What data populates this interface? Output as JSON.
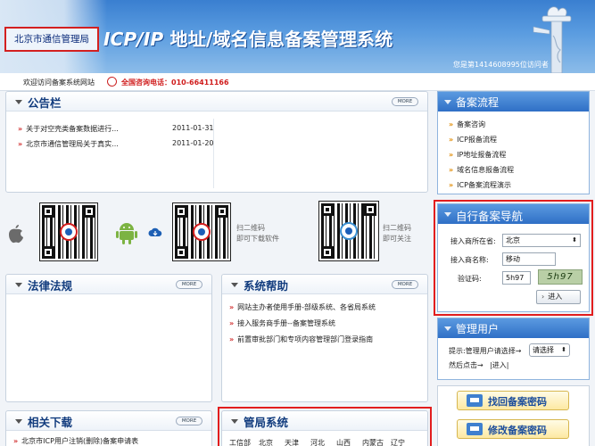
{
  "header": {
    "bureau_name": "北京市通信管理局",
    "title_latin": "ICP/IP",
    "title_cn": " 地址/域名信息备案管理系统",
    "visitor_text": "您是第1414608995位访问者"
  },
  "subbar": {
    "welcome": "欢迎访问备案系统网站",
    "hotline": "全国咨询电话：010-66411166"
  },
  "announcements": {
    "title": "公告栏",
    "more_label": "MORE",
    "items": [
      {
        "text": "关于对空壳类备案数据进行...",
        "date": "2011-01-31"
      },
      {
        "text": "北京市通信管理局关于真实...",
        "date": "2011-01-20"
      }
    ]
  },
  "downloads_strip": {
    "qr_caption_1": "扫二维码",
    "qr_caption_2": "即可下载软件",
    "follow_caption_1": "扫二维码",
    "follow_caption_2": "即可关注"
  },
  "law": {
    "title": "法律法规",
    "more_label": "MORE"
  },
  "help": {
    "title": "系统帮助",
    "more_label": "MORE",
    "items": [
      "网站主办者使用手册-部级系统、各省局系统",
      "接入服务商手册--备案管理系统",
      "前置审批部门和专项内容管理部门登录指南"
    ]
  },
  "related": {
    "title": "相关下载",
    "more_label": "MORE",
    "items": [
      "北京市ICP用户注销(删除)备案申请表"
    ]
  },
  "bureau_systems": {
    "title": "管局系统",
    "items": [
      "工信部",
      "北京",
      "天津",
      "河北",
      "山西",
      "内蒙古",
      "辽宁"
    ]
  },
  "process": {
    "title": "备案流程",
    "items": [
      "备案咨询",
      "ICP报备流程",
      "IP地址报备流程",
      "域名信息报备流程",
      "ICP备案流程演示"
    ]
  },
  "nav": {
    "title": "自行备案导航",
    "province_label": "接入商所在省:",
    "province_value": "北京",
    "name_label": "接入商名称:",
    "name_value": "移动",
    "captcha_label": "验证码:",
    "captcha_value": "5h97",
    "captcha_image_text": "5h97",
    "enter_label": "进入"
  },
  "admin": {
    "title": "管理用户",
    "hint_prefix": "提示:管理用户请选择→",
    "select_value": "请选择",
    "hint_suffix": "然后点击→",
    "enter_label": "|进入|"
  },
  "buttons": {
    "find_password": "找回备案密码",
    "change_password": "修改备案密码"
  },
  "colors": {
    "header_blue": "#3a7fd0",
    "highlight_red": "#e21d1d",
    "title_blue": "#123c7e",
    "hotline_red": "#d01d1d"
  }
}
